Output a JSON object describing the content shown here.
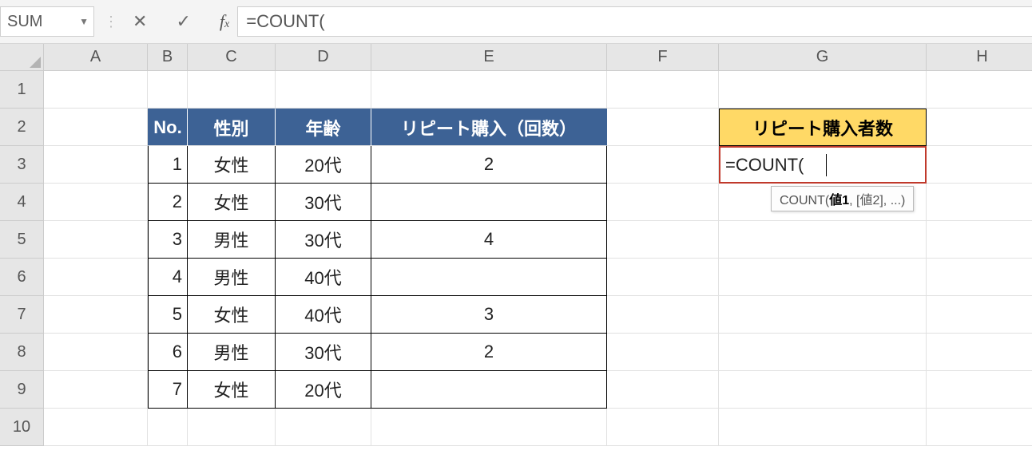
{
  "namebox": {
    "value": "SUM"
  },
  "formula_bar": {
    "text": "=COUNT("
  },
  "columns": [
    "A",
    "B",
    "C",
    "D",
    "E",
    "F",
    "G",
    "H"
  ],
  "rows": [
    "1",
    "2",
    "3",
    "4",
    "5",
    "6",
    "7",
    "8",
    "9",
    "10"
  ],
  "table": {
    "headers": {
      "no": "No.",
      "gender": "性別",
      "age": "年齢",
      "repeat": "リピート購入（回数）"
    },
    "rows": [
      {
        "no": "1",
        "gender": "女性",
        "age": "20代",
        "repeat": "2"
      },
      {
        "no": "2",
        "gender": "女性",
        "age": "30代",
        "repeat": ""
      },
      {
        "no": "3",
        "gender": "男性",
        "age": "30代",
        "repeat": "4"
      },
      {
        "no": "4",
        "gender": "男性",
        "age": "40代",
        "repeat": ""
      },
      {
        "no": "5",
        "gender": "女性",
        "age": "40代",
        "repeat": "3"
      },
      {
        "no": "6",
        "gender": "男性",
        "age": "30代",
        "repeat": "2"
      },
      {
        "no": "7",
        "gender": "女性",
        "age": "20代",
        "repeat": ""
      }
    ]
  },
  "result": {
    "header": "リピート購入者数",
    "editing_text": "=COUNT("
  },
  "tooltip": {
    "fn": "COUNT(",
    "arg1": "値1",
    "rest": ", [値2], ...)"
  }
}
